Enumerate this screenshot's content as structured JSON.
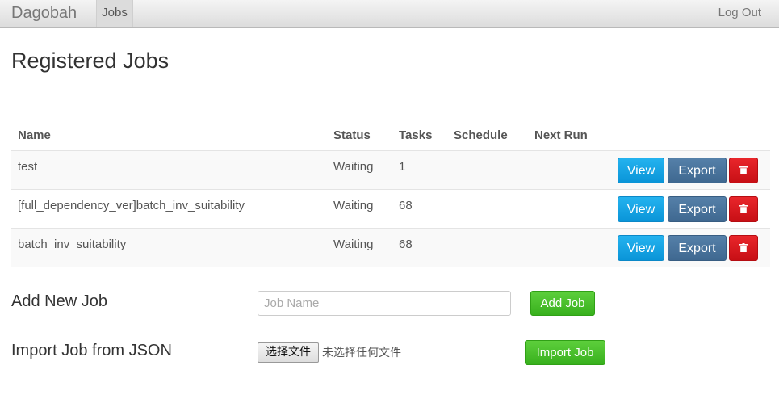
{
  "nav": {
    "brand": "Dagobah",
    "jobs_tab": "Jobs",
    "logout": "Log Out"
  },
  "page": {
    "title": "Registered Jobs"
  },
  "table": {
    "headers": {
      "name": "Name",
      "status": "Status",
      "tasks": "Tasks",
      "schedule": "Schedule",
      "next_run": "Next Run"
    },
    "rows": [
      {
        "name": "test",
        "status": "Waiting",
        "tasks": "1",
        "schedule": "",
        "next_run": ""
      },
      {
        "name": "[full_dependency_ver]batch_inv_suitability",
        "status": "Waiting",
        "tasks": "68",
        "schedule": "",
        "next_run": ""
      },
      {
        "name": "batch_inv_suitability",
        "status": "Waiting",
        "tasks": "68",
        "schedule": "",
        "next_run": ""
      }
    ],
    "actions": {
      "view": "View",
      "export": "Export",
      "delete_icon": "trash-icon"
    }
  },
  "add_job": {
    "label": "Add New Job",
    "placeholder": "Job Name",
    "value": "",
    "button": "Add Job"
  },
  "import_job": {
    "label": "Import Job from JSON",
    "file_button": "选择文件",
    "file_status": "未选择任何文件",
    "button": "Import Job"
  },
  "colors": {
    "view": "#14a5e6",
    "export": "#4a75a0",
    "delete": "#dc1a1f",
    "add": "#45be2b"
  }
}
